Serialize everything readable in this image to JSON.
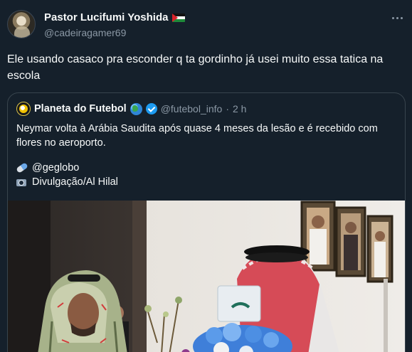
{
  "author": {
    "display_name": "Pastor Lucifumi Yoshida",
    "handle": "@cadeiragamer69",
    "flag_icon": "palestine-flag-icon"
  },
  "tweet": {
    "text": "Ele usando casaco pra esconder q ta gordinho já usei muito essa tatica na escola"
  },
  "quoted": {
    "display_name": "Planeta do Futebol",
    "handle": "@futebol_info",
    "separator": "·",
    "time": "2 h",
    "text": "Neymar volta à Arábia Saudita após quase 4 meses da lesão e é recebido com flores no aeroporto.",
    "credits": [
      {
        "icon": "pill-icon",
        "text": "@geglobo"
      },
      {
        "icon": "camera-flash-icon",
        "text": "Divulgação/Al Hilal"
      }
    ]
  },
  "colors": {
    "background": "#15202b",
    "text_primary": "#f7f9f9",
    "text_secondary": "#8b98a5",
    "border": "#38444d",
    "verified": "#1d9bf0"
  }
}
